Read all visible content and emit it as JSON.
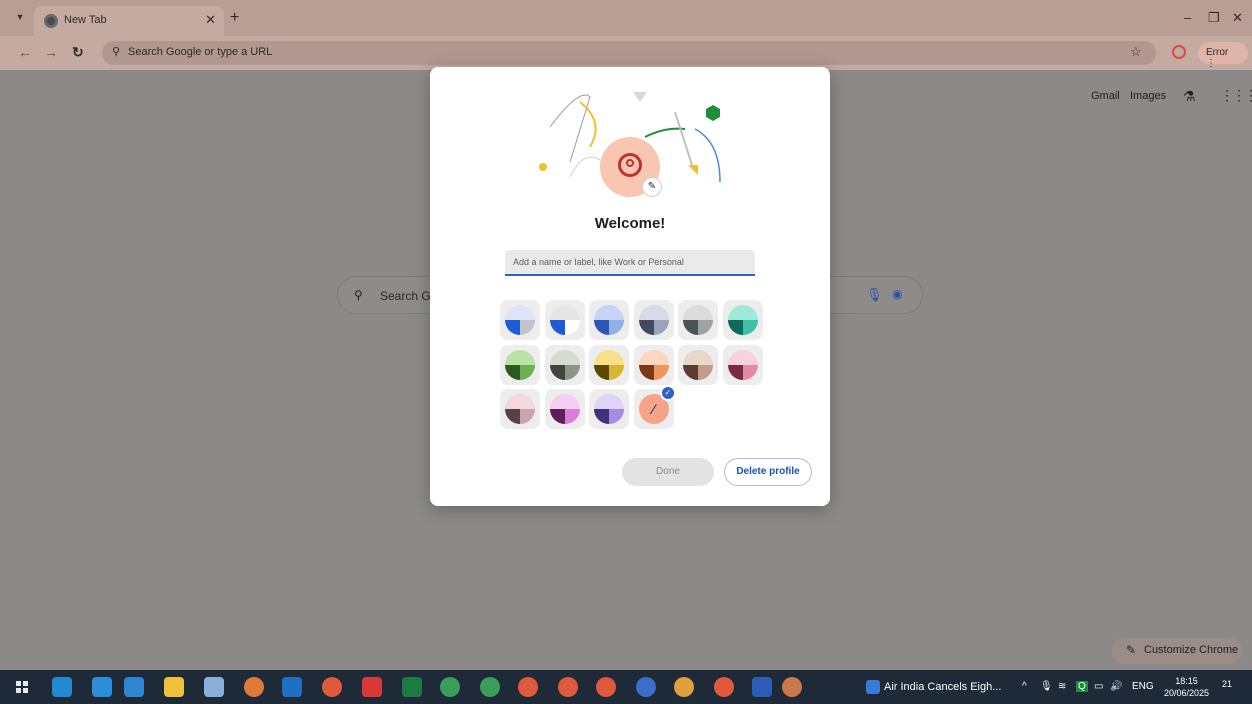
{
  "browser": {
    "tab_title": "New Tab",
    "address_placeholder": "Search Google or type a URL",
    "error_label": "Error"
  },
  "ntp": {
    "gmail_link": "Gmail",
    "images_link": "Images",
    "search_placeholder": "Search G",
    "customize_label": "Customize Chrome"
  },
  "dialog": {
    "title": "Welcome!",
    "name_placeholder": "Add a name or label, like Work or Personal",
    "done_label": "Done",
    "delete_label": "Delete profile",
    "color_swatches": [
      {
        "name": "swatch-blue",
        "c1": "#dde5f7",
        "c2": "#1e5bd6",
        "c3": "#c1c3c9"
      },
      {
        "name": "swatch-grey-blue",
        "c1": "#e6e6e6",
        "c2": "#1e5bd6",
        "c3": "#ffffff"
      },
      {
        "name": "swatch-light-blue",
        "c1": "#c7d4f6",
        "c2": "#2c55b6",
        "c3": "#8fb0e6"
      },
      {
        "name": "swatch-slate",
        "c1": "#d7dbe8",
        "c2": "#424a5e",
        "c3": "#9aa3ba"
      },
      {
        "name": "swatch-grey",
        "c1": "#dcdcdc",
        "c2": "#4a5558",
        "c3": "#9ba3a6"
      },
      {
        "name": "swatch-teal",
        "c1": "#9ee9d8",
        "c2": "#0f6b5d",
        "c3": "#3cc0a6"
      },
      {
        "name": "swatch-green",
        "c1": "#b9e2a6",
        "c2": "#2e5a1f",
        "c3": "#6fae55"
      },
      {
        "name": "swatch-sage",
        "c1": "#d7dcd0",
        "c2": "#3f463c",
        "c3": "#8c9485"
      },
      {
        "name": "swatch-yellow",
        "c1": "#f7e08a",
        "c2": "#5a4a00",
        "c3": "#d8b532"
      },
      {
        "name": "swatch-orange",
        "c1": "#fbd7c2",
        "c2": "#7a3a14",
        "c3": "#ee965e"
      },
      {
        "name": "swatch-beige",
        "c1": "#ead7cc",
        "c2": "#5a3d30",
        "c3": "#c29c88"
      },
      {
        "name": "swatch-pink",
        "c1": "#f7d1dc",
        "c2": "#7a2a3e",
        "c3": "#e58aa3"
      },
      {
        "name": "swatch-rose",
        "c1": "#f2d9dc",
        "c2": "#5a4044",
        "c3": "#c9a6ab"
      },
      {
        "name": "swatch-magenta",
        "c1": "#f4cdf4",
        "c2": "#5c1f5c",
        "c3": "#d97fd9"
      },
      {
        "name": "swatch-purple",
        "c1": "#e0d4f6",
        "c2": "#42307a",
        "c3": "#a38ce1"
      }
    ],
    "custom_swatch_color": "#f5a48a",
    "accent_color": "#2a62c9"
  },
  "taskbar": {
    "news_text": "Air India Cancels Eigh...",
    "language": "ENG",
    "time": "18:15",
    "date": "20/06/2025",
    "notification_count": "21"
  }
}
